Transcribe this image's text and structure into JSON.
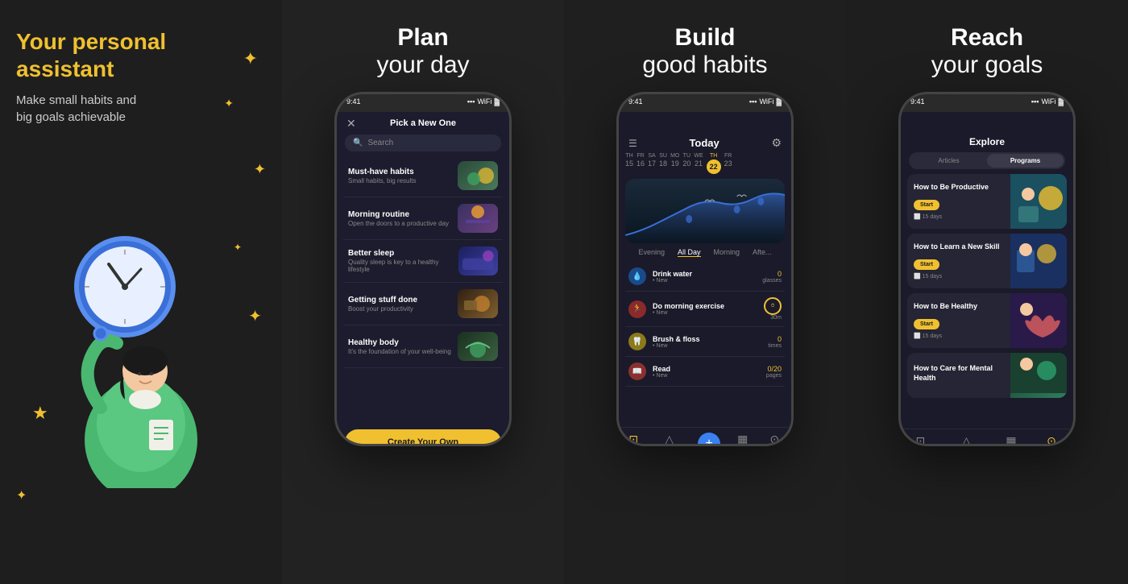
{
  "panel1": {
    "headline": "Your personal\nassistant",
    "subtext": "Make small habits and\nbig goals achievable"
  },
  "panel2": {
    "title_bold": "Plan",
    "title_light": "your day",
    "phone": {
      "time": "9:41",
      "topbar_title": "Pick a New One",
      "search_placeholder": "Search",
      "habits": [
        {
          "name": "Must-have habits",
          "desc": "Small habits, big results",
          "thumb": "food"
        },
        {
          "name": "Morning routine",
          "desc": "Open the doors to a productive day",
          "thumb": "morning"
        },
        {
          "name": "Better sleep",
          "desc": "Quality sleep is key to a healthy lifestyle",
          "thumb": "sleep"
        },
        {
          "name": "Getting stuff done",
          "desc": "Boost your productivity",
          "thumb": "stuff"
        },
        {
          "name": "Healthy body",
          "desc": "It's the foundation of your well-being",
          "thumb": "healthy"
        }
      ],
      "create_btn": "Create Your Own"
    }
  },
  "panel3": {
    "title_bold": "Build",
    "title_light": "good habits",
    "phone": {
      "time": "9:41",
      "screen_title": "Today",
      "dates": [
        {
          "day": "TH",
          "num": "15"
        },
        {
          "day": "FR",
          "num": "16"
        },
        {
          "day": "SA",
          "num": "17"
        },
        {
          "day": "SU",
          "num": "18"
        },
        {
          "day": "MO",
          "num": "19"
        },
        {
          "day": "TU",
          "num": "20"
        },
        {
          "day": "WE",
          "num": "21"
        },
        {
          "day": "TH",
          "num": "22",
          "active": true
        },
        {
          "day": "FR",
          "num": "23"
        }
      ],
      "filters": [
        "Evening",
        "All Day",
        "Morning",
        "Afte..."
      ],
      "active_filter": "All Day",
      "habits": [
        {
          "name": "Drink water",
          "sub": "New",
          "count": "0",
          "unit": "glasses",
          "icon": "💧",
          "icon_class": "habit-icon-blue"
        },
        {
          "name": "Do morning exercise",
          "sub": "New",
          "count": "30m",
          "unit": "",
          "icon": "🏃",
          "icon_class": "habit-icon-red"
        },
        {
          "name": "Brush & floss",
          "sub": "New",
          "count": "0",
          "unit": "times",
          "icon": "🦷",
          "icon_class": "habit-icon-yellow"
        },
        {
          "name": "Read",
          "sub": "New",
          "count": "0/20",
          "unit": "pages",
          "icon": "📖",
          "icon_class": "habit-icon-red2"
        }
      ],
      "nav": [
        "Today",
        "Challenges",
        "Habits",
        "Explore"
      ]
    }
  },
  "panel4": {
    "title_bold": "Reach",
    "title_light": "your goals",
    "phone": {
      "time": "9:41",
      "screen_title": "Explore",
      "tabs": [
        "Articles",
        "Programs"
      ],
      "active_tab": "Programs",
      "cards": [
        {
          "title": "How to Be Productive",
          "days": "15 days",
          "thumb": "productive"
        },
        {
          "title": "How to Learn a New Skill",
          "days": "15 days",
          "thumb": "skill"
        },
        {
          "title": "How to Be Healthy",
          "days": "15 days",
          "thumb": "healthy2"
        },
        {
          "title": "How to Care for Mental Health",
          "days": "",
          "thumb": "mental"
        }
      ],
      "start_label": "Start",
      "nav": [
        "Today",
        "Challenges",
        "Stats",
        "Explore"
      ],
      "active_nav": "Explore"
    }
  }
}
